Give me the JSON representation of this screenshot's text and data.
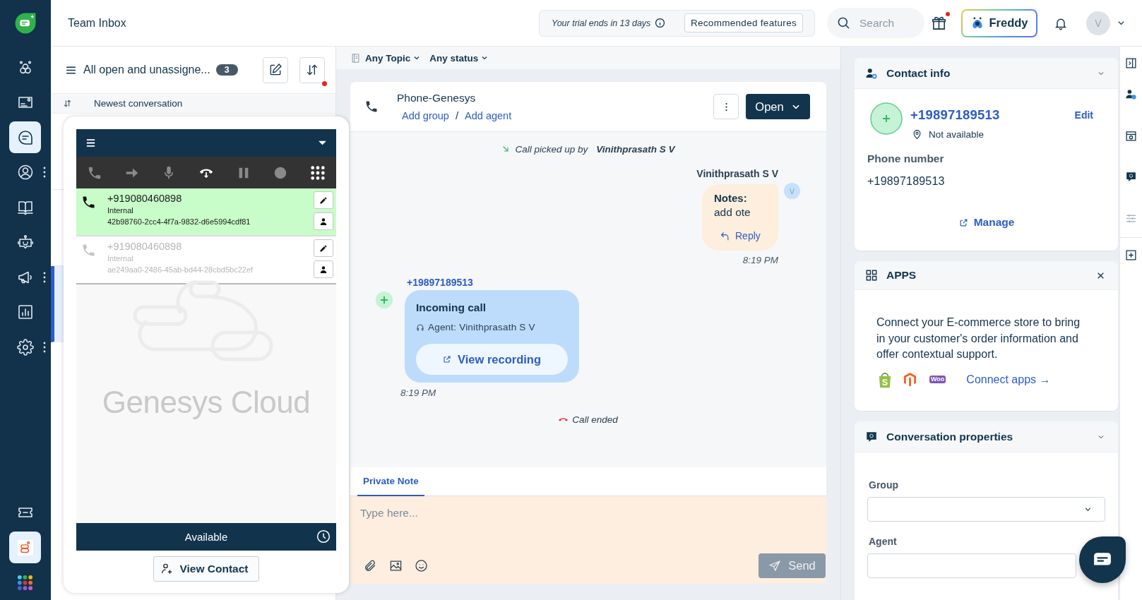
{
  "nav": {
    "items": [
      {
        "selected": false,
        "more": false
      },
      {
        "selected": false,
        "more": false
      },
      {
        "selected": true,
        "more": false
      },
      {
        "selected": false,
        "more": true
      },
      {
        "selected": false,
        "more": false
      },
      {
        "selected": false,
        "more": false
      },
      {
        "selected": false,
        "more": true
      },
      {
        "selected": false,
        "more": false
      },
      {
        "selected": false,
        "more": true
      }
    ],
    "bottom_items": [
      {
        "selected": false
      },
      {
        "selected": true
      },
      {
        "selected": false
      }
    ]
  },
  "header": {
    "title": "Team Inbox",
    "trial_notice": "Your trial ends in 13 days",
    "recommended_button": "Recommended features",
    "search": {
      "placeholder": "Search"
    },
    "gift_notification": true,
    "freddy_button": "Freddy",
    "avatar": "V"
  },
  "inbox": {
    "view_name": "All open and unassigne...",
    "count": "3",
    "sort_notification": true,
    "sort_label": "Newest conversation",
    "conversations": [
      {
        "selected": false
      },
      {
        "selected": false
      },
      {
        "selected": true
      }
    ]
  },
  "softphone": {
    "controls": [
      {
        "enabled": false
      },
      {
        "enabled": false
      },
      {
        "enabled": false
      },
      {
        "enabled": true
      },
      {
        "enabled": false
      },
      {
        "enabled": false
      },
      {
        "enabled": true
      }
    ],
    "interactions": [
      {
        "number": "+919080460898",
        "type": "Internal",
        "id": "42b98760-2cc4-4f7a-9832-d6e5994cdf81",
        "selected": true
      },
      {
        "number": "+919080460898",
        "type": "Internal",
        "id": "ae249aa0-2486-45ab-bd44-28cbd5bc22ef",
        "selected": false
      }
    ],
    "logo_text": "Genesys Cloud",
    "status": "Available",
    "view_contact_button": "View Contact"
  },
  "conversation": {
    "filters": [
      {
        "label": "Any Topic"
      },
      {
        "label": "Any status"
      }
    ],
    "channel": "Phone-Genesys",
    "links": [
      "Add group",
      "Add agent"
    ],
    "separator": "/",
    "status_button": "Open",
    "timeline": [
      {
        "kind": "picked",
        "text": "Call picked up by",
        "actor": "Vinithprasath S V"
      },
      {
        "kind": "note",
        "sender": "Vinithprasath S V",
        "title": "Notes:",
        "body": "add ote",
        "action": "Reply",
        "avatar": "V",
        "time": "8:19 PM"
      },
      {
        "kind": "call",
        "sender": "+19897189513",
        "title": "Incoming call",
        "agent": "Agent: Vinithprasath S V",
        "action": "View recording",
        "time": "8:19 PM"
      },
      {
        "kind": "ended",
        "text": "Call ended"
      }
    ],
    "composer": {
      "tabs": [
        {
          "label": "Private Note",
          "selected": true
        }
      ],
      "placeholder": "Type here...",
      "send_button": "Send",
      "send_disabled": true
    }
  },
  "contact": {
    "title": "Contact info",
    "name": "+19897189513",
    "edit": "Edit",
    "location": "Not available",
    "fields": [
      {
        "label": "Phone number",
        "value": "+19897189513"
      }
    ],
    "manage": "Manage"
  },
  "apps": {
    "title": "APPS",
    "text": "Connect your E-commerce store to bring in your customer's order information and offer contextual support.",
    "logos": [
      {
        "kind": "bag",
        "mark": "S"
      },
      {
        "kind": "hexagon"
      },
      {
        "kind": "badge",
        "mark": "Woo"
      }
    ],
    "link": "Connect apps →"
  },
  "properties": {
    "title": "Conversation properties",
    "fields": [
      {
        "label": "Group",
        "kind": "select"
      },
      {
        "label": "Agent",
        "kind": "input"
      }
    ]
  }
}
